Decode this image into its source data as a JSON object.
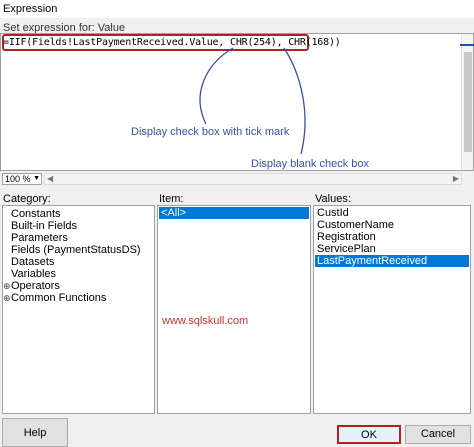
{
  "window": {
    "title": "Expression"
  },
  "editor": {
    "label": "Set expression for: Value",
    "code": "=IIF(Fields!LastPaymentReceived.Value, CHR(254), CHR(168))",
    "annotation_1": "Display check box with tick mark",
    "annotation_2": "Display blank check box"
  },
  "zoom": {
    "value": "100 %"
  },
  "category": {
    "label": "Category:",
    "items": [
      {
        "label": "Constants",
        "expandable": false
      },
      {
        "label": "Built-in Fields",
        "expandable": false
      },
      {
        "label": "Parameters",
        "expandable": false
      },
      {
        "label": "Fields (PaymentStatusDS)",
        "expandable": false
      },
      {
        "label": "Datasets",
        "expandable": false
      },
      {
        "label": "Variables",
        "expandable": false
      },
      {
        "label": "Operators",
        "expandable": true
      },
      {
        "label": "Common Functions",
        "expandable": true
      }
    ]
  },
  "item": {
    "label": "Item:",
    "items": [
      {
        "label": "<All>",
        "selected": true
      }
    ]
  },
  "values": {
    "label": "Values:",
    "items": [
      {
        "label": "CustId",
        "selected": false
      },
      {
        "label": "CustomerName",
        "selected": false
      },
      {
        "label": "Registration",
        "selected": false
      },
      {
        "label": "ServicePlan",
        "selected": false
      },
      {
        "label": "LastPaymentReceived",
        "selected": true
      }
    ]
  },
  "watermark": "www.sqlskull.com",
  "buttons": {
    "help": "Help",
    "ok": "OK",
    "cancel": "Cancel"
  },
  "colors": {
    "selection": "#0078d7",
    "annotation": "#3a4fa3",
    "highlight": "#b22222"
  }
}
